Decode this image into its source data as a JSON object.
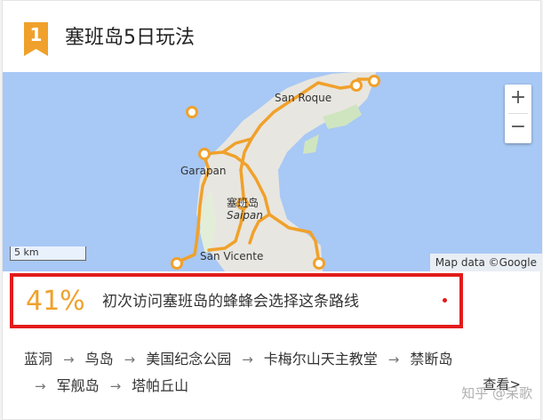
{
  "header": {
    "rank": "1",
    "title": "塞班岛5日玩法"
  },
  "map": {
    "labels": {
      "san_roque": "San Roque",
      "garapan": "Garapan",
      "saipan_cn": "塞班岛",
      "saipan": "Saipan",
      "san_vicente": "San Vicente"
    },
    "zoom_in": "+",
    "zoom_out": "−",
    "scale": "5 km",
    "attribution": "Map data ©Google",
    "colors": {
      "water": "#a8c8f5",
      "land": "#e8e6e0",
      "route": "#f0a12b"
    }
  },
  "stat": {
    "percent": "41%",
    "text": "初次访问塞班岛的蜂蜂会选择这条路线"
  },
  "route": {
    "stops": [
      "蓝洞",
      "鸟岛",
      "美国纪念公园",
      "卡梅尔山天主教堂",
      "禁断岛",
      "军舰岛",
      "塔帕丘山"
    ],
    "arrow": "→",
    "more": "查看>"
  },
  "watermark": "知乎 @呆歌"
}
